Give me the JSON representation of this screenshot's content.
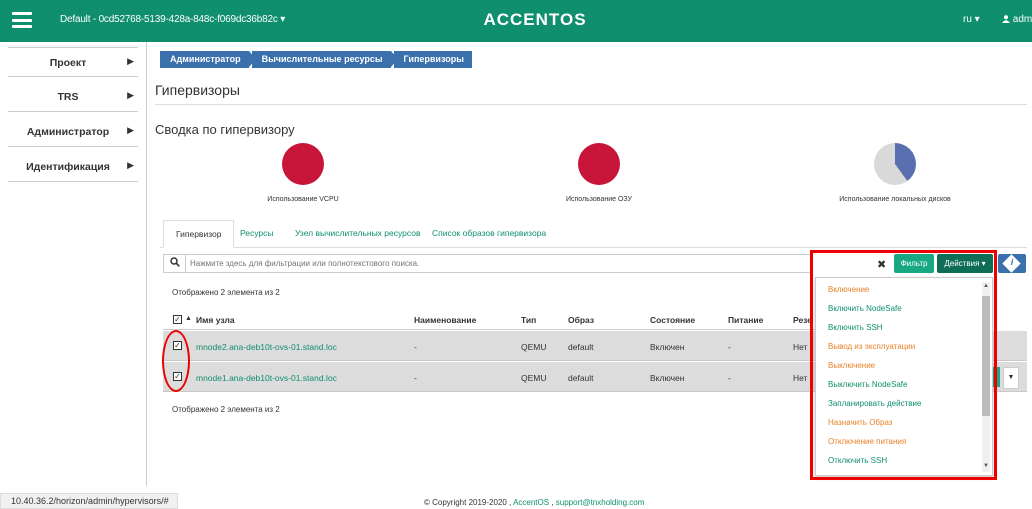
{
  "header": {
    "project_selector": "Default - 0cd52768-5139-428a-848c-f069dc36b82c ▾",
    "logo": "ACCENTOS",
    "language": "ru ▾",
    "user": "admin"
  },
  "sidebar": {
    "items": [
      {
        "label": "Проект"
      },
      {
        "label": "TRS"
      },
      {
        "label": "Администратор"
      },
      {
        "label": "Идентификация"
      }
    ]
  },
  "breadcrumb": [
    "Администратор",
    "Вычислительные ресурсы",
    "Гипервизоры"
  ],
  "page_title": "Гипервизоры",
  "summary": {
    "title": "Сводка по гипервизору",
    "charts": [
      {
        "label": "Использование VCPU",
        "used_fraction": 1.0,
        "color": "#c8163a"
      },
      {
        "label": "Использование ОЗУ",
        "used_fraction": 1.0,
        "color": "#c8163a"
      },
      {
        "label": "Использование локальных дисков",
        "used_fraction": 0.4,
        "color": "#5a6fb0"
      }
    ]
  },
  "tabs": [
    {
      "label": "Гипервизор",
      "active": true
    },
    {
      "label": "Ресурсы",
      "active": false
    },
    {
      "label": "Узел вычислительных ресурсов",
      "active": false
    },
    {
      "label": "Список образов гипервизора",
      "active": false
    }
  ],
  "filter": {
    "placeholder": "Нажмите здесь для фильтрации или полнотекстового поиска.",
    "clear": "✖",
    "filter_button": "Фильтр",
    "actions_button": "Действия ▾"
  },
  "table": {
    "count_top": "Отображено 2 элемента из 2",
    "count_bottom": "Отображено 2 элемента из 2",
    "sort_indicator": "▲",
    "columns": [
      "Имя узла",
      "Наименование",
      "Тип",
      "Образ",
      "Состояние",
      "Питание",
      "Резе"
    ],
    "rows": [
      {
        "host": "mnode2.ana-deb10t-ovs-01.stand.loc",
        "name": "-",
        "type": "QEMU",
        "image": "default",
        "state": "Включен",
        "power": "-",
        "reserved": "Нет"
      },
      {
        "host": "mnode1.ana-deb10t-ovs-01.stand.loc",
        "name": "-",
        "type": "QEMU",
        "image": "default",
        "state": "Включен",
        "power": "-",
        "reserved": "Нет"
      }
    ]
  },
  "actions_menu": [
    {
      "label": "Включение",
      "tone": "off"
    },
    {
      "label": "Включить NodeSafe",
      "tone": "on"
    },
    {
      "label": "Включить SSH",
      "tone": "on"
    },
    {
      "label": "Вывод из эксплуатации",
      "tone": "off"
    },
    {
      "label": "Выключение",
      "tone": "off"
    },
    {
      "label": "Выключить NodeSafe",
      "tone": "on"
    },
    {
      "label": "Запланировать действие",
      "tone": "on"
    },
    {
      "label": "Назначить Образ",
      "tone": "off"
    },
    {
      "label": "Отключение питания",
      "tone": "off"
    },
    {
      "label": "Отключить SSH",
      "tone": "on"
    }
  ],
  "footer": {
    "status_url": "10.40.36.2/horizon/admin/hypervisors/#",
    "copyright_prefix": "© Copyright 2019-2020 ,",
    "copyright_link": "AccentOS",
    "copyright_sep": ",",
    "copyright_email": "support@tnxholding.com"
  },
  "colors": {
    "brand": "#0f8f6e",
    "breadcrumb": "#3a71ad",
    "annotation": "#ee0000"
  }
}
